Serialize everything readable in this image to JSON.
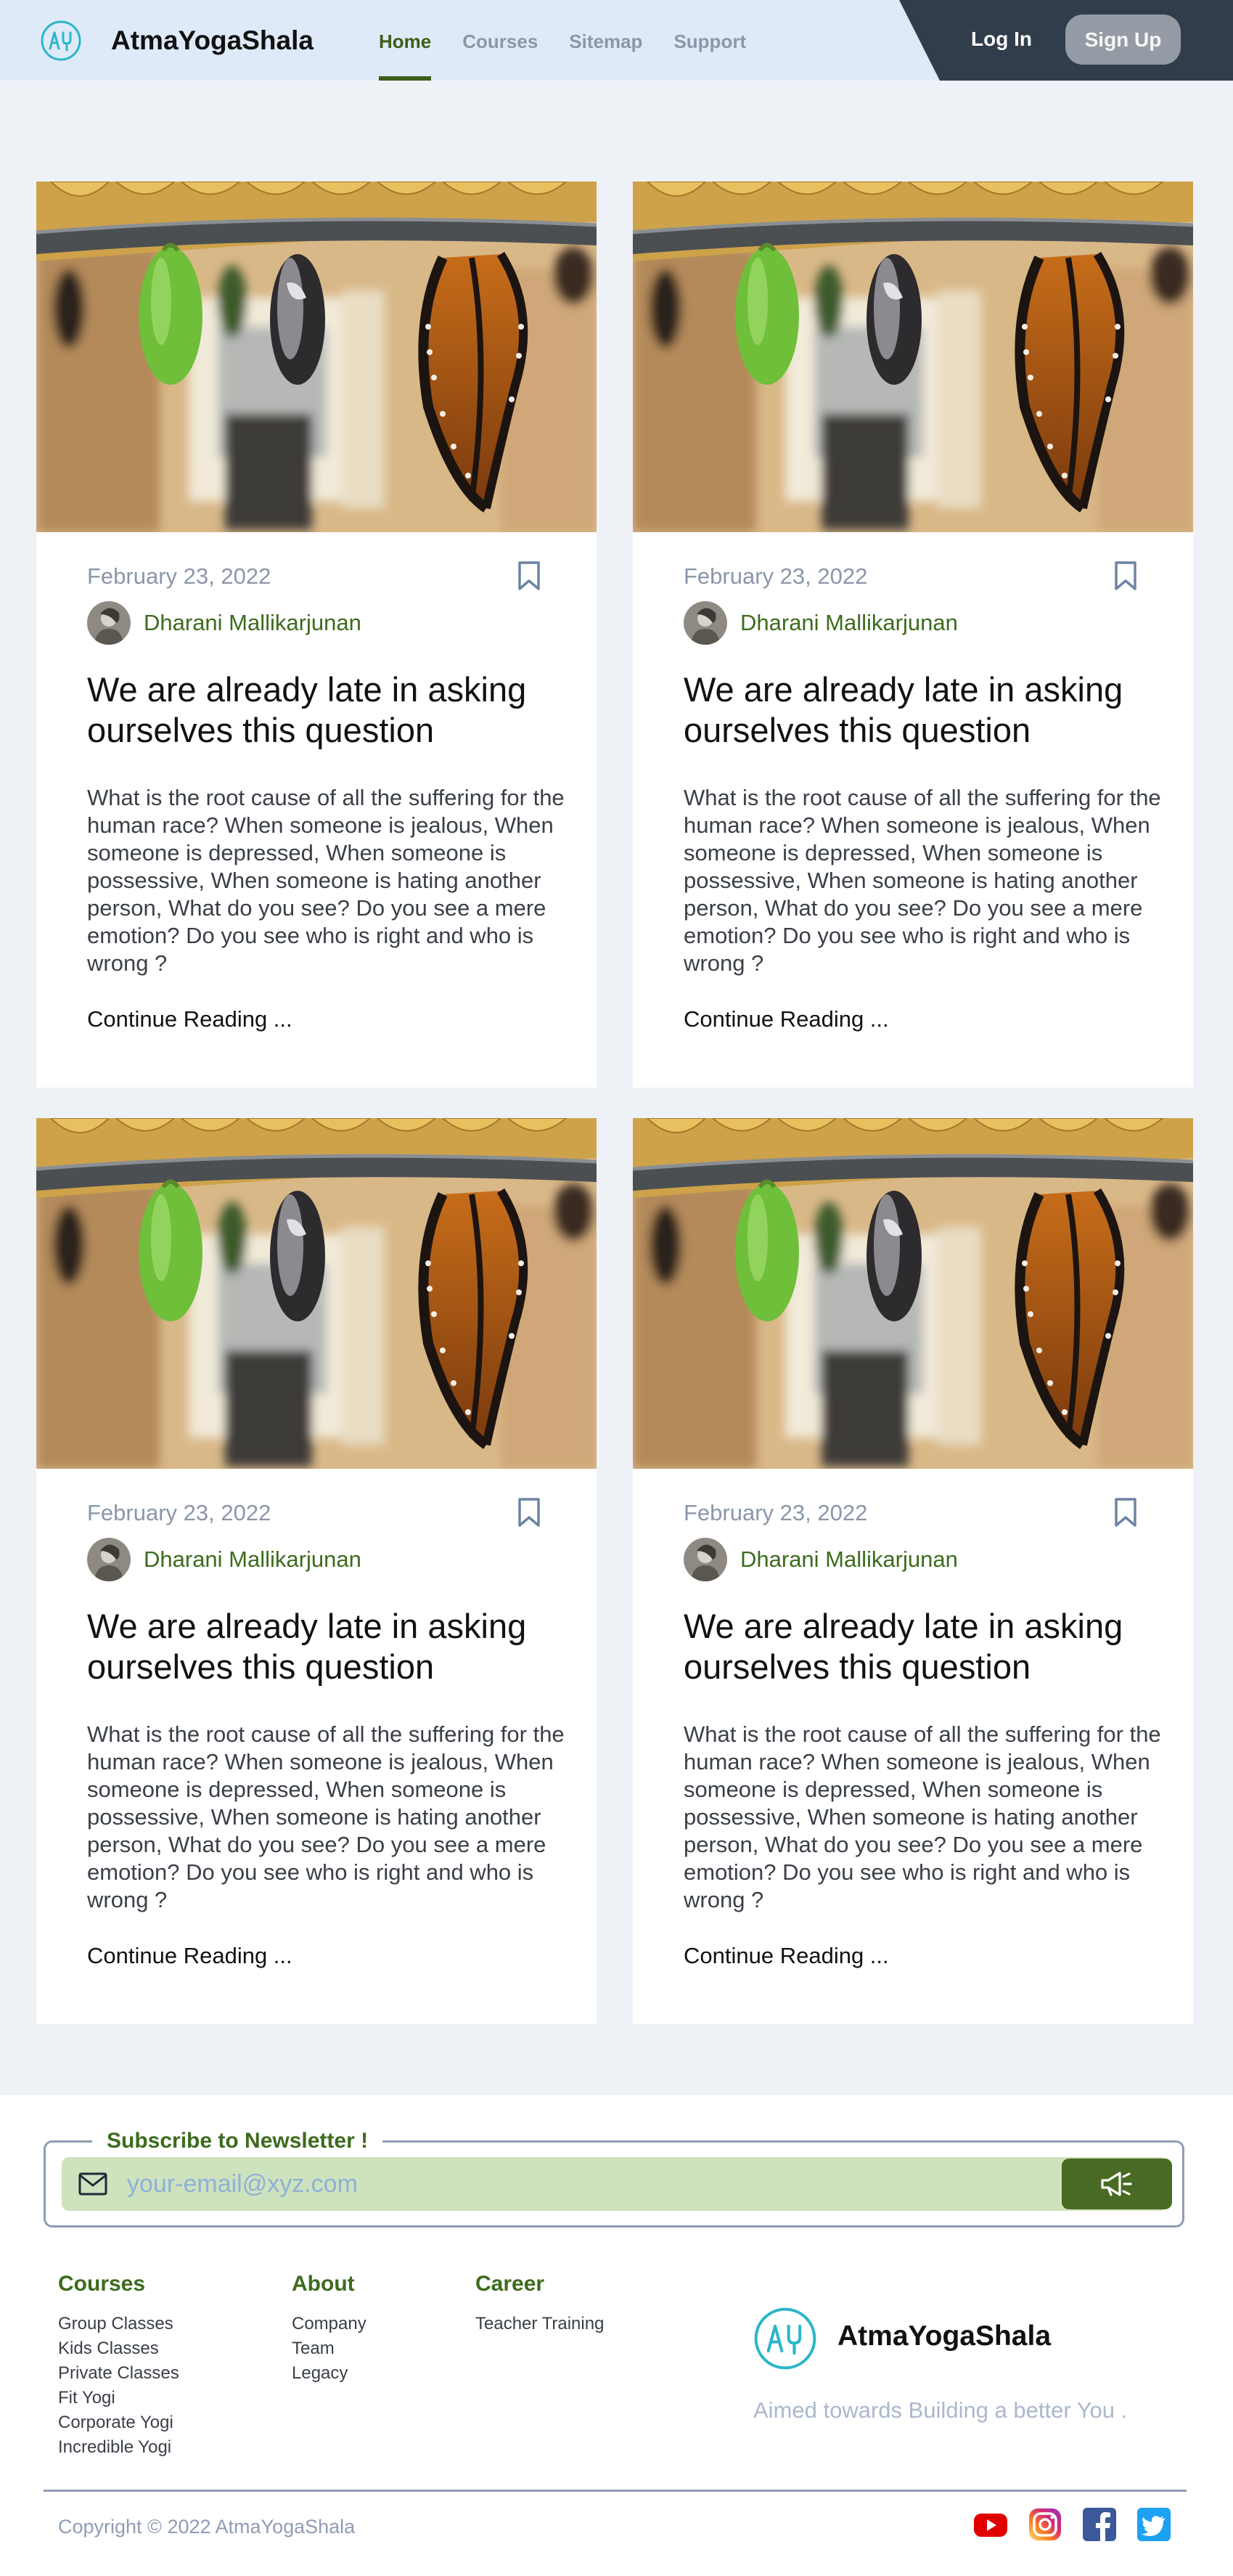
{
  "header": {
    "brand": "AtmaYogaShala",
    "nav": [
      {
        "label": "Home",
        "active": true
      },
      {
        "label": "Courses"
      },
      {
        "label": "Sitemap"
      },
      {
        "label": "Support"
      }
    ],
    "login_label": "Log In",
    "signup_label": "Sign Up"
  },
  "colors": {
    "accent": "#3d6b1d",
    "header_bg": "#deeaf8",
    "header_dark": "#323d4b",
    "page_bg": "#eef2f7",
    "subscribe_btn": "#496a22"
  },
  "cards": [
    {
      "date": "February 23, 2022",
      "author": "Dharani Mallikarjunan",
      "title": "We are already late in asking ourselves this question",
      "body": "What is the root cause of all the suffering for the human race? When someone is jealous, When someone is depressed, When someone is possessive, When someone is hating another person, What do you see? Do you see a mere emotion? Do you see who is right and who is wrong ?",
      "more": "Continue Reading ..."
    },
    {
      "date": "February 23, 2022",
      "author": "Dharani Mallikarjunan",
      "title": "We are already late in asking ourselves this question",
      "body": "What is the root cause of all the suffering for the human race? When someone is jealous, When someone is depressed, When someone is possessive, When someone is hating another person, What do you see? Do you see a mere emotion? Do you see who is right and who is wrong ?",
      "more": "Continue Reading ..."
    },
    {
      "date": "February 23, 2022",
      "author": "Dharani Mallikarjunan",
      "title": "We are already late in asking ourselves this question",
      "body": "What is the root cause of all the suffering for the human race? When someone is jealous, When someone is depressed, When someone is possessive, When someone is hating another person, What do you see? Do you see a mere emotion? Do you see who is right and who is wrong ?",
      "more": "Continue Reading ..."
    },
    {
      "date": "February 23, 2022",
      "author": "Dharani Mallikarjunan",
      "title": "We are already late in asking ourselves this question",
      "body": "What is the root cause of all the suffering for the human race? When someone is jealous, When someone is depressed, When someone is possessive, When someone is hating another person, What do you see? Do you see a mere emotion? Do you see who is right and who is wrong ?",
      "more": "Continue Reading ..."
    }
  ],
  "icons": {
    "bookmark": "bookmark-icon",
    "mail": "mail-icon",
    "megaphone": "megaphone-icon",
    "logo": "logo-icon"
  },
  "newsletter": {
    "legend": "Subscribe to Newsletter !",
    "placeholder": "your-email@xyz.com"
  },
  "footer": {
    "courses": {
      "heading": "Courses",
      "items": [
        "Group Classes",
        "Kids Classes",
        "Private Classes",
        "Fit Yogi",
        "Corporate Yogi",
        "Incredible Yogi"
      ]
    },
    "about": {
      "heading": "About",
      "items": [
        "Company",
        "Team",
        "Legacy"
      ]
    },
    "career": {
      "heading": "Career",
      "items": [
        "Teacher Training"
      ]
    },
    "brand": "AtmaYogaShala",
    "tagline": "Aimed towards Building a better You .",
    "copyright": "Copyright © 2022 AtmaYogaShala",
    "social": [
      "youtube-icon",
      "instagram-icon",
      "facebook-icon",
      "twitter-icon"
    ]
  }
}
